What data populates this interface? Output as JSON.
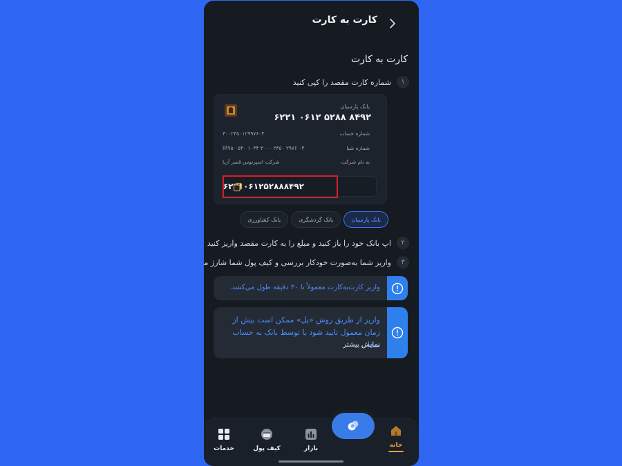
{
  "header": {
    "title": "کارت به کارت"
  },
  "section": {
    "title": "کارت به کارت"
  },
  "steps": [
    {
      "num": "۱",
      "text": "شماره کارت مقصد را کپی کنید"
    },
    {
      "num": "۲",
      "text": "اپ بانک خود را باز کنید و مبلغ را به کارت مقصد واریز کنید"
    },
    {
      "num": "۳",
      "text": "واریز شما به‌صورت خودکار بررسی و کیف پول شما شارژ می‌شود"
    }
  ],
  "card": {
    "bank_label": "بانک  پارسیان",
    "card_number": "۶۲۲۱ ۰۶۱۲ ۵۲۸۸ ۸۴۹۲",
    "account_label": "شماره حساب",
    "account_value": "۳۰۰۲۳۵۰۱۲۹۹۷۶۰۴",
    "sheba_label": "شماره شبا",
    "sheba_value": "IR۹۵ ۰۵۴۰ ۱۰۳۴ ۳۰۰۰ ۲۳۵۰ ۲۹۷۶ ۰۴",
    "owner_label": "به نام شرکت",
    "owner_value": "شرکت اسپرتوس قصر آریا",
    "copy_value": "۶۲۲۱۰۶۱۲۵۲۸۸۸۴۹۲"
  },
  "banks": [
    {
      "label": "بانک  پارسیان",
      "active": true
    },
    {
      "label": "بانک  گردشگری",
      "active": false
    },
    {
      "label": "بانک  کشاورزی",
      "active": false
    }
  ],
  "alerts": {
    "first": "واریز کارت‌به‌کارت معمولاً تا ۳۰ دقیقه طول می‌کشد.",
    "second": "واریز از طریق روش «پل» ممکن است بیش از زمان معمول تایید شود یا توسط بانک به حساب مبدا ...",
    "more": "نمایش بیشتر"
  },
  "nav": {
    "home": "خانه",
    "market": "بازار",
    "wallet": "کیف پول",
    "services": "خدمات"
  },
  "colors": {
    "accent": "#3a7bea",
    "home_active": "#e6a23c",
    "background": "#161b22",
    "page": "#3067f2"
  }
}
